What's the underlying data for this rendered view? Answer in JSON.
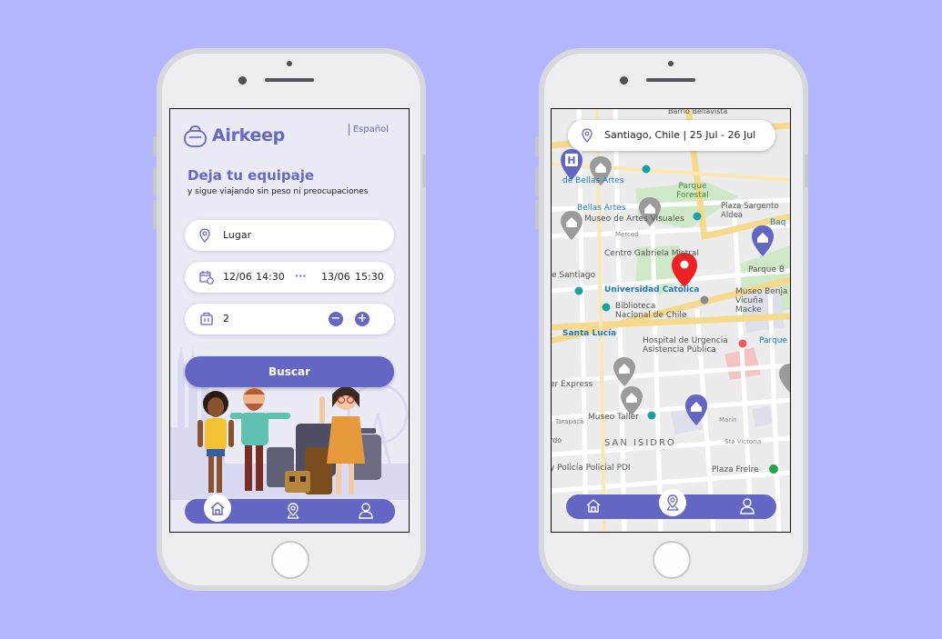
{
  "colors": {
    "background": "#b3b5fd",
    "accent": "#6466c4",
    "map_pin_red": "#ee2222",
    "map_marker_purple": "#6466c4",
    "map_marker_gray": "#9b9b9b"
  },
  "app_screen": {
    "brand": "Airkeep",
    "language": "Español",
    "headline": "Deja tu equipaje",
    "subheadline": "y sigue viajando sin peso ni preocupaciones",
    "location_field": {
      "placeholder": "Lugar",
      "icon": "location-pin-icon"
    },
    "dates_field": {
      "icon": "calendar-icon",
      "start_date": "12/06",
      "start_time": "14:30",
      "separator": "···",
      "end_date": "13/06",
      "end_time": "15:30"
    },
    "bags_field": {
      "icon": "luggage-icon",
      "count": "2",
      "minus": "−",
      "plus": "+"
    },
    "search_button": "Buscar",
    "nav": [
      {
        "name": "home",
        "icon": "home-icon",
        "active": true
      },
      {
        "name": "map",
        "icon": "map-pin-icon",
        "active": false
      },
      {
        "name": "profile",
        "icon": "user-icon",
        "active": false
      }
    ]
  },
  "map_screen": {
    "search_text": "Santiago, Chile | 25 Jul - 26 Jul",
    "map_labels": [
      "Barrio Bellavista",
      "de Bellas Artes",
      "Parque Forestal",
      "Bellas Artes",
      "Museo de Artes Visuales",
      "Plaza Sargento Aldea",
      "Baq",
      "Merced",
      "Centro Gabriela Mistral",
      "Parque B",
      "Museo Benja Vicuña Macke",
      "e Santiago",
      "Universidad Católica",
      "Biblioteca Nacional de Chile",
      "Santa Lucía",
      "Hospital de Urgencia Asistencia Pública",
      "Parque",
      "Museo Taller",
      "SAN ISIDRO",
      "Plaza Freire",
      "y Policía Policial PDI",
      "rdo",
      "Tarapacá",
      "Marín",
      "Sta Victoria",
      "er Express"
    ],
    "nav": [
      {
        "name": "home",
        "icon": "home-icon",
        "active": false
      },
      {
        "name": "map",
        "icon": "map-pin-icon",
        "active": true
      },
      {
        "name": "profile",
        "icon": "user-icon",
        "active": false
      }
    ]
  }
}
